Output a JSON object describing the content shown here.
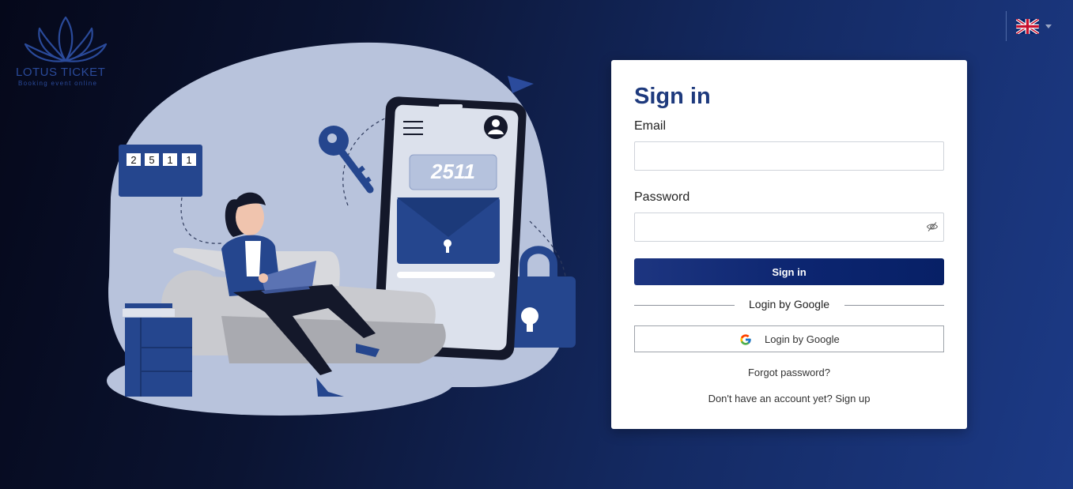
{
  "logo": {
    "title": "LOTUS TICKET",
    "subtitle": "Booking event online",
    "icon": "lotus-icon",
    "color": "#2a4a9a"
  },
  "language": {
    "icon": "uk-flag-icon",
    "dropdown_icon": "caret-down-icon"
  },
  "illustration": {
    "pin_digits": [
      "2",
      "5",
      "1",
      "1"
    ],
    "phone_code": "2511"
  },
  "form": {
    "title": "Sign in",
    "email_label": "Email",
    "email_value": "",
    "password_label": "Password",
    "password_value": "",
    "password_toggle_icon": "eye-slash-icon",
    "signin_button": "Sign in",
    "divider_text": "Login by Google",
    "google_button": "Login by Google",
    "google_icon": "google-icon",
    "forgot_password": "Forgot password?",
    "no_account_text": "Don't have an account yet?",
    "signup_link": "Sign up"
  },
  "colors": {
    "primary": "#1e3a7d",
    "button": "#0c2570",
    "card": "#ffffff"
  }
}
